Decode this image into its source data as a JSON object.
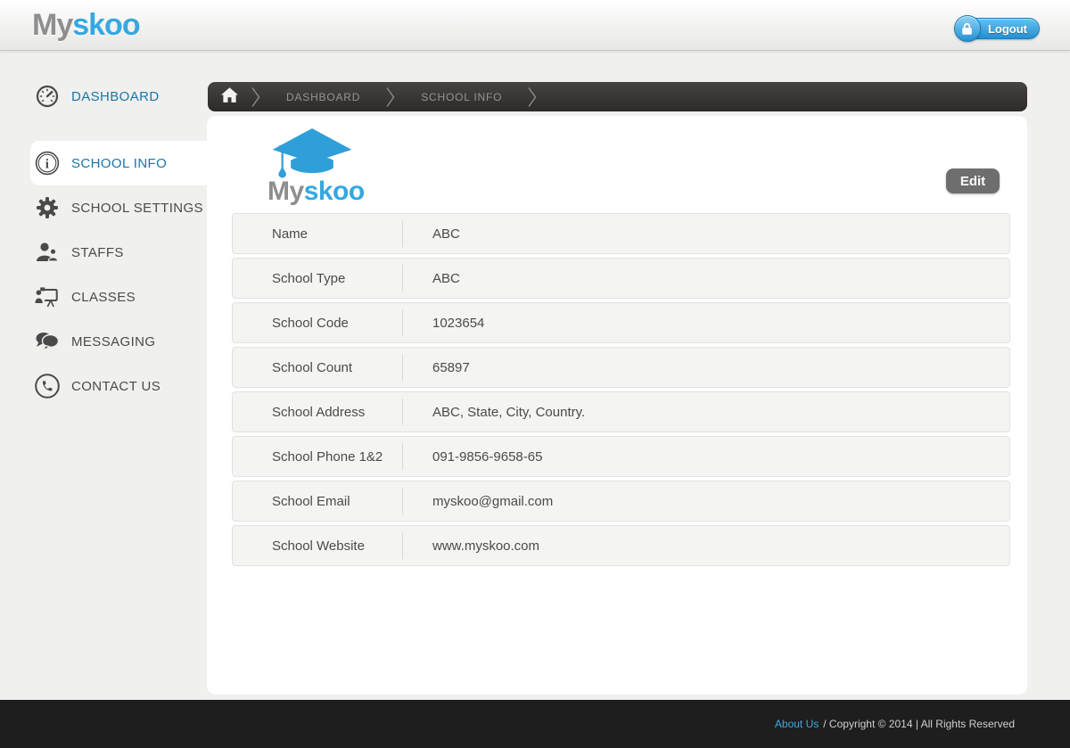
{
  "header": {
    "logo_part1": "My",
    "logo_part2": "skoo",
    "logout_label": "Logout"
  },
  "sidebar": {
    "items": [
      {
        "label": "DASHBOARD",
        "icon": "speedometer-icon"
      },
      {
        "label": "SCHOOL INFO",
        "icon": "info-icon",
        "active": true
      },
      {
        "label": "SCHOOL SETTINGS",
        "icon": "gear-icon"
      },
      {
        "label": "STAFFS",
        "icon": "people-icon"
      },
      {
        "label": "CLASSES",
        "icon": "presentation-icon"
      },
      {
        "label": "MESSAGING",
        "icon": "speech-bubbles-icon"
      },
      {
        "label": "CONTACT US",
        "icon": "phone-icon"
      }
    ]
  },
  "breadcrumb": {
    "items": [
      "DASHBOARD",
      "SCHOOL INFO"
    ]
  },
  "main": {
    "logo_part1": "My",
    "logo_part2": "skoo",
    "edit_label": "Edit",
    "info_rows": [
      {
        "label": "Name",
        "value": "ABC"
      },
      {
        "label": "School Type",
        "value": "ABC"
      },
      {
        "label": "School Code",
        "value": "1023654"
      },
      {
        "label": "School Count",
        "value": "65897"
      },
      {
        "label": "School Address",
        "value": "ABC, State, City, Country."
      },
      {
        "label": "School Phone 1&2",
        "value": "091-9856-9658-65"
      },
      {
        "label": "School Email",
        "value": "myskoo@gmail.com"
      },
      {
        "label": "School Website",
        "value": "www.myskoo.com"
      }
    ]
  },
  "footer": {
    "about_link": "About Us",
    "text": "/ Copyright © 2014  |  All Rights Reserved"
  },
  "colors": {
    "accent_blue": "#35a8e0",
    "sidebar_link_blue": "#1b76a8",
    "dark_text": "#4a4a4a",
    "breadcrumb_bg": "#3a3634",
    "footer_bg": "#1e1e1e"
  }
}
